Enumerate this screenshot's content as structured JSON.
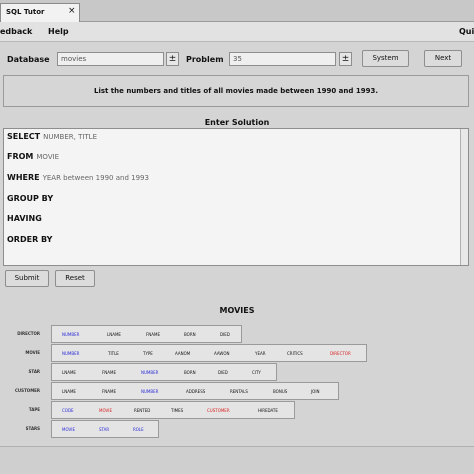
{
  "window": {
    "tab_title": "SQL Tutor",
    "tab_close": "×"
  },
  "menubar": {
    "feedback": "edback",
    "help": "Help",
    "quit": "Qui"
  },
  "toolbar": {
    "database_label": "Database",
    "database_value": "movies",
    "database_spin": "±",
    "problem_label": "Problem",
    "problem_value": "35",
    "problem_spin": "±",
    "system_button": "System",
    "next_button": "Next"
  },
  "question": {
    "text": "List the numbers and titles of all movies made between 1990 and 1993."
  },
  "solution": {
    "heading": "Enter Solution",
    "clauses": [
      {
        "keyword": "SELECT",
        "value": "NUMBER, TITLE"
      },
      {
        "keyword": "FROM",
        "value": "MOVIE"
      },
      {
        "keyword": "WHERE",
        "value": "YEAR between 1990 and 1993"
      },
      {
        "keyword": "GROUP BY",
        "value": ""
      },
      {
        "keyword": "HAVING",
        "value": ""
      },
      {
        "keyword": "ORDER BY",
        "value": ""
      }
    ],
    "submit_button": "Submit",
    "reset_button": "Reset"
  },
  "schema": {
    "title": "MOVIES",
    "tables": [
      {
        "name": "DIRECTOR",
        "columns": [
          {
            "name": "NUMBER",
            "color": "#2a2ad8"
          },
          {
            "name": "LNAME",
            "color": "#111111"
          },
          {
            "name": "FNAME",
            "color": "#111111"
          },
          {
            "name": "BORN",
            "color": "#111111"
          },
          {
            "name": "DIED",
            "color": "#111111"
          }
        ]
      },
      {
        "name": "MOVIE",
        "columns": [
          {
            "name": "NUMBER",
            "color": "#2a2ad8"
          },
          {
            "name": "TITLE",
            "color": "#111111"
          },
          {
            "name": "TYPE",
            "color": "#111111"
          },
          {
            "name": "AANOM",
            "color": "#111111"
          },
          {
            "name": "AAWON",
            "color": "#111111"
          },
          {
            "name": "YEAR",
            "color": "#111111"
          },
          {
            "name": "CRITICS",
            "color": "#111111"
          },
          {
            "name": "DIRECTOR",
            "color": "#d82020"
          }
        ]
      },
      {
        "name": "STAR",
        "columns": [
          {
            "name": "LNAME",
            "color": "#111111"
          },
          {
            "name": "FNAME",
            "color": "#111111"
          },
          {
            "name": "NUMBER",
            "color": "#2a2ad8"
          },
          {
            "name": "BORN",
            "color": "#111111"
          },
          {
            "name": "DIED",
            "color": "#111111"
          },
          {
            "name": "CITY",
            "color": "#111111"
          }
        ]
      },
      {
        "name": "CUSTOMER",
        "columns": [
          {
            "name": "LNAME",
            "color": "#111111"
          },
          {
            "name": "FNAME",
            "color": "#111111"
          },
          {
            "name": "NUMBER",
            "color": "#2a2ad8"
          },
          {
            "name": "ADDRESS",
            "color": "#111111"
          },
          {
            "name": "RENTALS",
            "color": "#111111"
          },
          {
            "name": "BONUS",
            "color": "#111111"
          },
          {
            "name": "JOIN",
            "color": "#111111"
          }
        ]
      },
      {
        "name": "TAPE",
        "columns": [
          {
            "name": "CODE",
            "color": "#2a2ad8"
          },
          {
            "name": "MOVIE",
            "color": "#d82020"
          },
          {
            "name": "RENTED",
            "color": "#111111"
          },
          {
            "name": "TIMES",
            "color": "#111111"
          },
          {
            "name": "CUSTOMER",
            "color": "#d82020"
          },
          {
            "name": "HIREDATE",
            "color": "#111111"
          }
        ]
      },
      {
        "name": "STARS",
        "columns": [
          {
            "name": "MOVIE",
            "color": "#2a2ad8"
          },
          {
            "name": "STAR",
            "color": "#2a2ad8"
          },
          {
            "name": "ROLE",
            "color": "#2a2ad8"
          }
        ]
      }
    ]
  }
}
